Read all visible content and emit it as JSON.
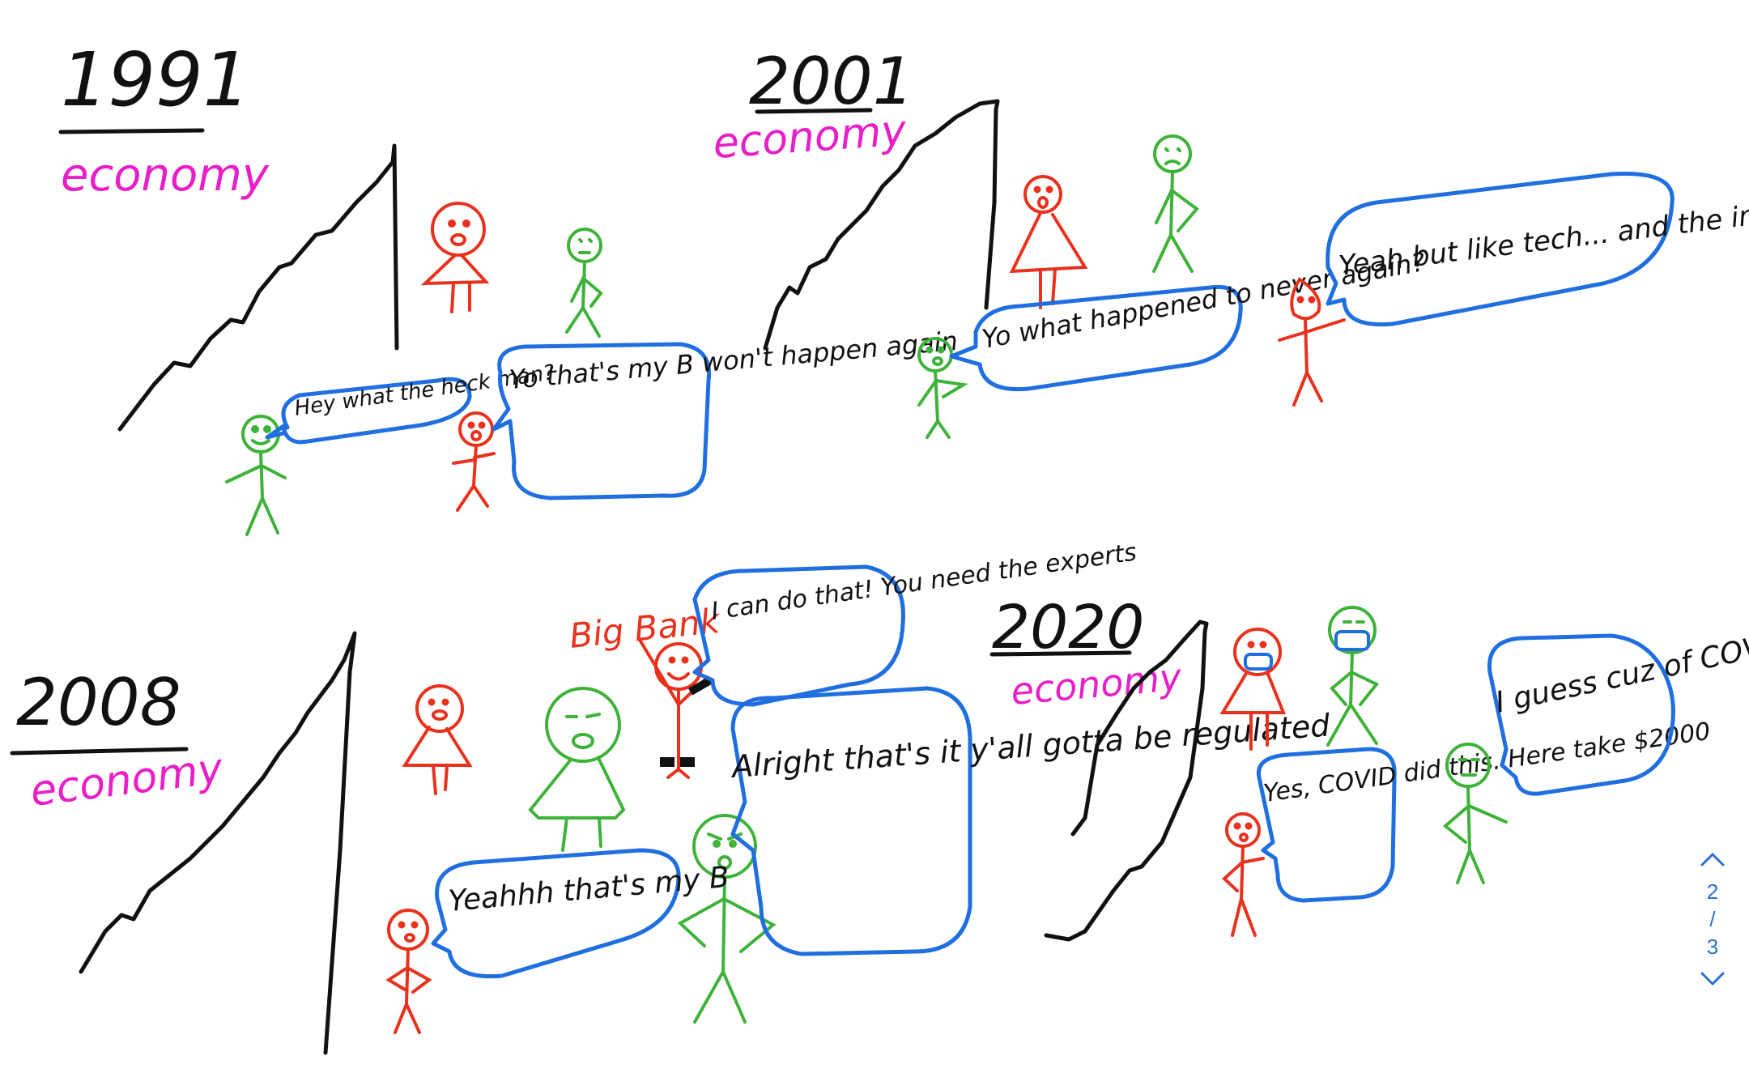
{
  "panels": [
    {
      "year": "1991",
      "label": "economy",
      "bubbles": [
        "Hey what the heck man?",
        "Yo that's my B won't happen again"
      ]
    },
    {
      "year": "2001",
      "label": "economy",
      "bubbles": [
        "Yo what happened to never again?",
        "Yeah but like tech... and the internet"
      ]
    },
    {
      "year": "2008",
      "label": "economy",
      "bank_label": "Big Bank",
      "bubbles": [
        "I can do that! You need the experts",
        "Alright that's it y'all gotta be regulated",
        "Yeahhh that's my B"
      ]
    },
    {
      "year": "2020",
      "label": "economy",
      "bubbles": [
        "Yes, COVID did this. Here take $2000",
        "I guess cuz of COVID?"
      ]
    }
  ],
  "pager": {
    "current": "2",
    "separator": "/",
    "total": "3"
  },
  "colors": {
    "ink": "#111111",
    "economy": "#e81fc8",
    "bubble": "#1f6fe0",
    "red": "#e8321e",
    "green": "#3fb23a",
    "pager": "#2b6fd6"
  }
}
